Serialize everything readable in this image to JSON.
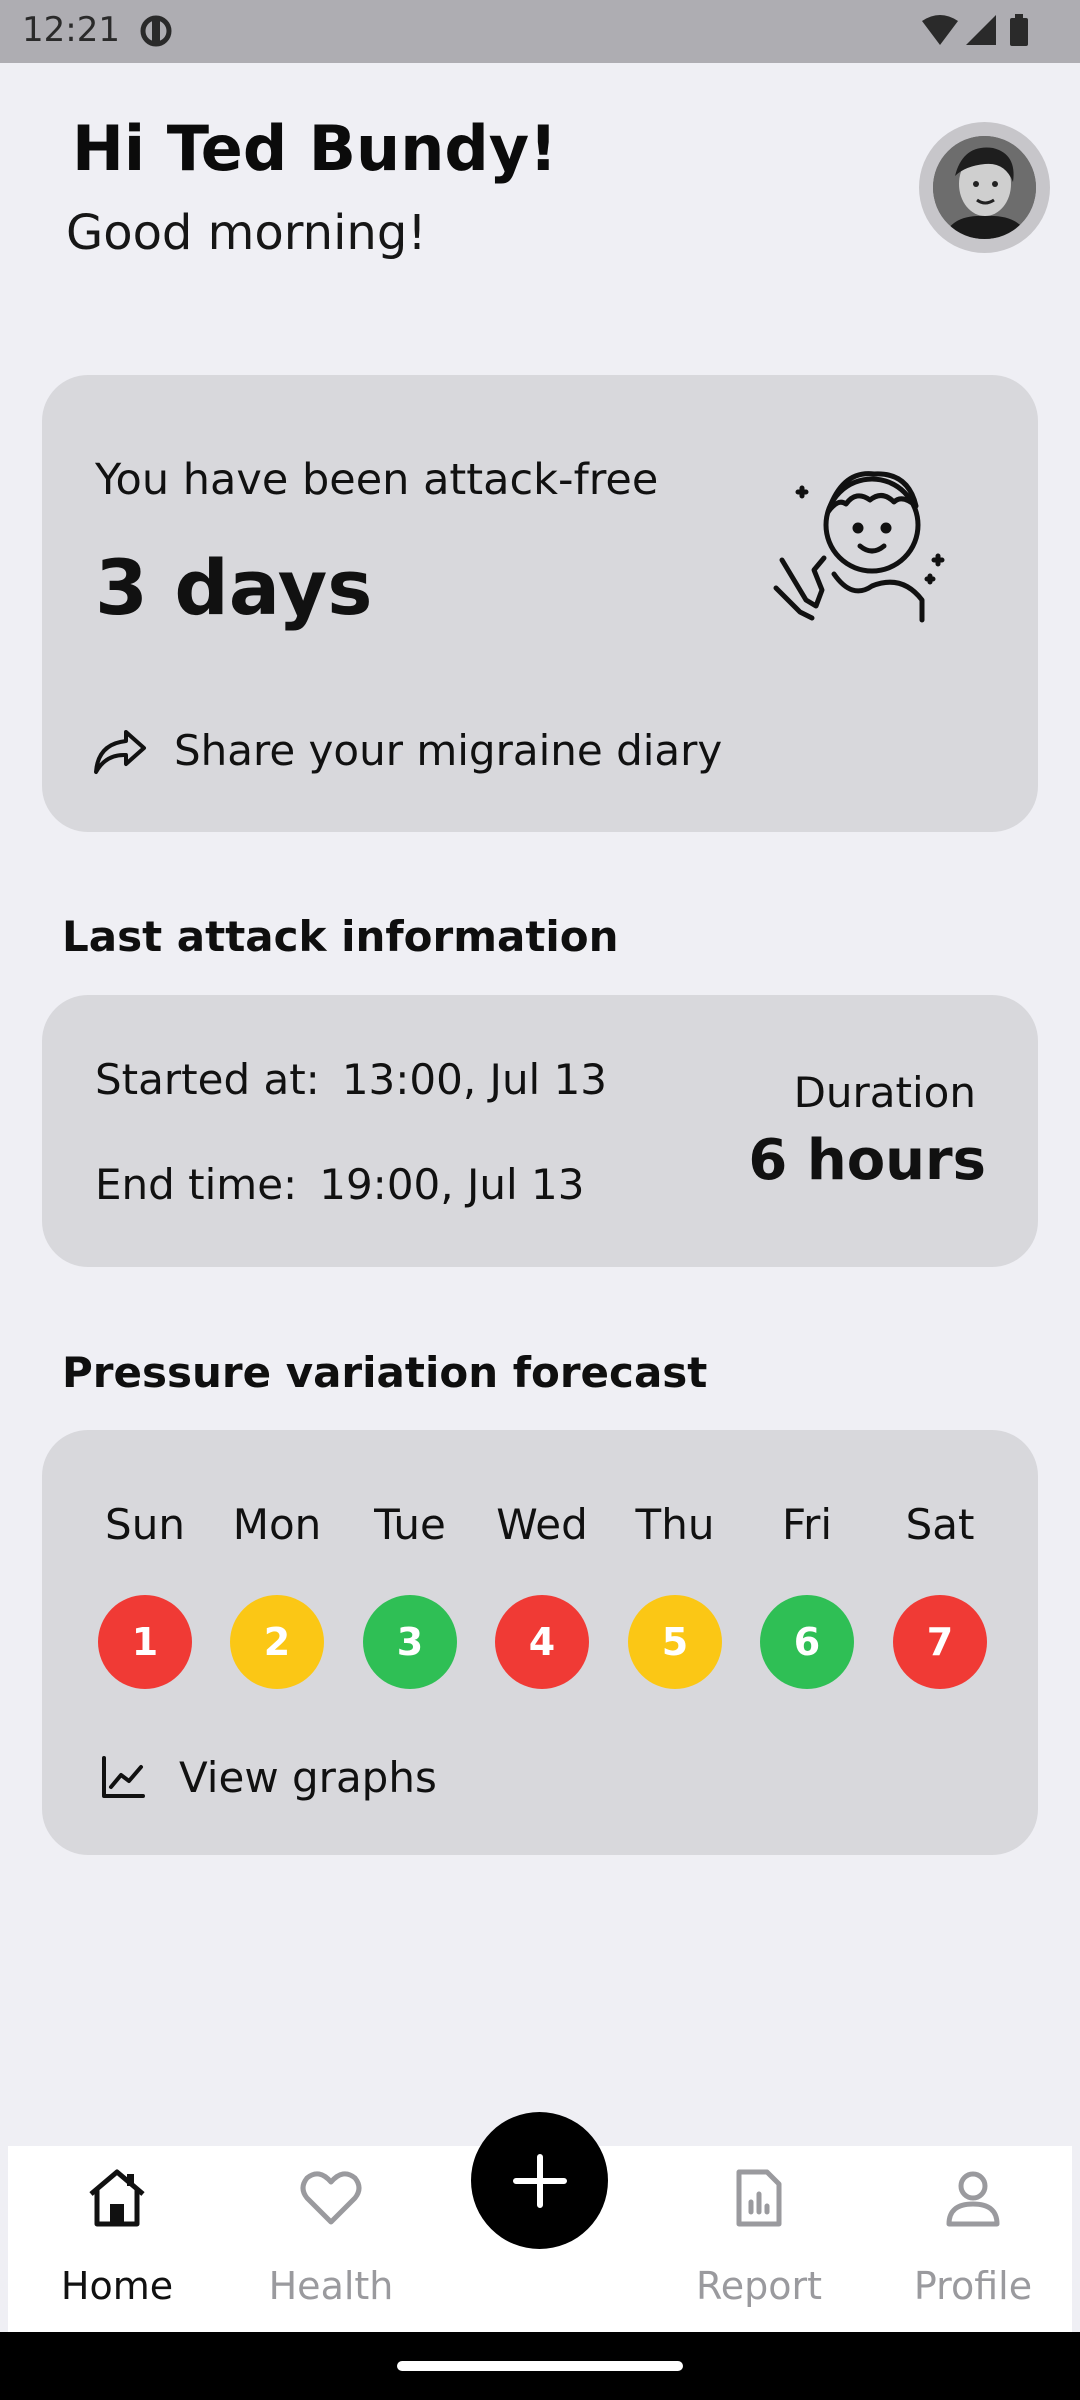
{
  "status_bar": {
    "time": "12:21"
  },
  "header": {
    "greeting": "Hi Ted Bundy!",
    "subgreeting": "Good morning!"
  },
  "attack_free_card": {
    "label": "You have been attack-free",
    "value": "3 days",
    "share_label": "Share your migraine diary"
  },
  "last_attack": {
    "section_title": "Last attack information",
    "started_label": "Started at:",
    "started_value": "13:00, Jul 13",
    "end_label": "End time:",
    "end_value": "19:00, Jul 13",
    "duration_label": "Duration",
    "duration_value": "6 hours"
  },
  "pressure": {
    "section_title": "Pressure variation forecast",
    "days": [
      {
        "label": "Sun",
        "value": "1",
        "color": "#f03a35"
      },
      {
        "label": "Mon",
        "value": "2",
        "color": "#fbc715"
      },
      {
        "label": "Tue",
        "value": "3",
        "color": "#2fbf55"
      },
      {
        "label": "Wed",
        "value": "4",
        "color": "#f03a35"
      },
      {
        "label": "Thu",
        "value": "5",
        "color": "#fbc715"
      },
      {
        "label": "Fri",
        "value": "6",
        "color": "#2fbf55"
      },
      {
        "label": "Sat",
        "value": "7",
        "color": "#f03a35"
      }
    ],
    "graphs_label": "View graphs"
  },
  "bottom_nav": {
    "items": [
      {
        "label": "Home",
        "icon": "home-icon",
        "active": true
      },
      {
        "label": "Health",
        "icon": "heart-icon",
        "active": false
      },
      {
        "label": "Report",
        "icon": "report-icon",
        "active": false
      },
      {
        "label": "Profile",
        "icon": "profile-icon",
        "active": false
      }
    ],
    "fab_icon": "plus-icon"
  },
  "colors": {
    "background": "#efeff4",
    "card": "#d8d8dc",
    "red": "#f03a35",
    "yellow": "#fbc715",
    "green": "#2fbf55"
  }
}
